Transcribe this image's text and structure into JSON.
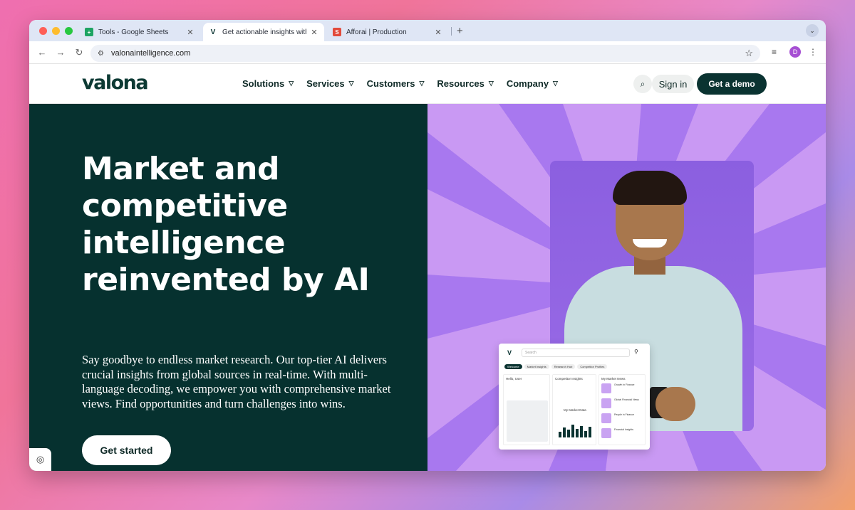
{
  "browser": {
    "tabs": [
      {
        "title": "Tools - Google Sheets",
        "favicon_color": "#1fa463",
        "favicon_glyph": "+"
      },
      {
        "title": "Get actionable insights with V",
        "favicon_color": "#0a3331",
        "favicon_glyph": "V"
      },
      {
        "title": "Afforai | Production",
        "favicon_color": "#e24a3b",
        "favicon_glyph": "S"
      }
    ],
    "url": "valonaintelligence.com",
    "avatar_letter": "D"
  },
  "site": {
    "logo": "valona",
    "nav": [
      "Solutions",
      "Services",
      "Customers",
      "Resources",
      "Company"
    ],
    "signin": "Sign in",
    "demo": "Get a demo"
  },
  "hero": {
    "headline": "Market and competitive intelligence reinvented by AI",
    "subtitle": "Say goodbye to endless market research. Our top-tier AI delivers crucial insights from global sources in real-time. With multi-language decoding, we empower you with comprehensive market views. Find opportunities and turn challenges into wins.",
    "cta": "Get started"
  },
  "dashboard": {
    "logo": "V",
    "search_placeholder": "Search",
    "chips": [
      "Welcome",
      "Market Insights",
      "Research Hub",
      "Competitor Profiles"
    ],
    "panels": [
      "Hello, User",
      "Competitor Insights",
      "My Market News"
    ],
    "chart_title": "My Market Data",
    "news_items": [
      "Growth in Finance",
      "Global Financial News",
      "People in Finance",
      "Financial Insights"
    ]
  },
  "colors": {
    "brand_dark": "#0a3331",
    "hero_left_bg": "#06312f",
    "hero_right_bg": "#c999f3",
    "card_bg": "#8b5fe0"
  }
}
